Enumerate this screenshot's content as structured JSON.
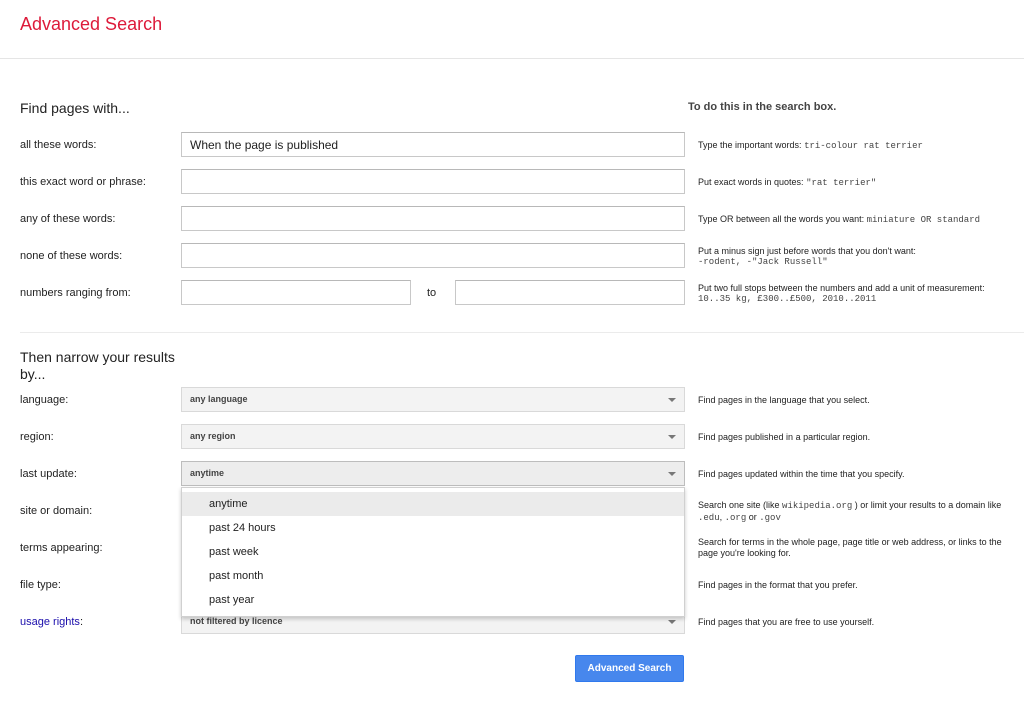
{
  "header": {
    "title": "Advanced Search"
  },
  "find": {
    "title": "Find pages with...",
    "hint_heading": "To do this in the search box.",
    "all_words": {
      "label": "all these words:",
      "value": "When the page is published",
      "hint": "Type the important words: ",
      "hint_example": "tri-colour rat terrier"
    },
    "exact_phrase": {
      "label": "this exact word or phrase:",
      "value": "",
      "hint": "Put exact words in quotes: ",
      "hint_example": "\"rat terrier\""
    },
    "any_words": {
      "label": "any of these words:",
      "value": "",
      "hint": "Type OR between all the words you want: ",
      "hint_example": "miniature OR standard"
    },
    "none_words": {
      "label": "none of these words:",
      "value": "",
      "hint": "Put a minus sign just before words that you don't want:",
      "hint_example": "-rodent, -\"Jack Russell\""
    },
    "numbers": {
      "label": "numbers ranging from:",
      "from_value": "",
      "to_label": "to",
      "to_value": "",
      "hint": "Put two full stops between the numbers and add a unit of measurement:",
      "hint_example": "10..35 kg, £300..£500, 2010..2011"
    }
  },
  "narrow": {
    "title": "Then narrow your results by...",
    "language": {
      "label": "language:",
      "value": "any language",
      "hint": "Find pages in the language that you select."
    },
    "region": {
      "label": "region:",
      "value": "any region",
      "hint": "Find pages published in a particular region."
    },
    "last_update": {
      "label": "last update:",
      "value": "anytime",
      "hint": "Find pages updated within the time that you specify."
    },
    "site": {
      "label": "site or domain:",
      "hint_1": "Search one site (like ",
      "hint_code_1": "wikipedia.org",
      "hint_2": " ) or limit your results to a domain like ",
      "hint_code_2": ".edu",
      "hint_3": ", ",
      "hint_code_3": ".org",
      "hint_4": " or ",
      "hint_code_4": ".gov"
    },
    "terms": {
      "label": "terms appearing:",
      "hint": "Search for terms in the whole page, page title or web address, or links to the page you're looking for."
    },
    "file_type": {
      "label": "file type:",
      "hint": "Find pages in the format that you prefer."
    },
    "usage_rights": {
      "label": "usage rights",
      "colon": ":",
      "value": "not filtered by licence",
      "hint": "Find pages that you are free to use yourself."
    }
  },
  "dropdown": {
    "options": [
      "anytime",
      "past 24 hours",
      "past week",
      "past month",
      "past year"
    ],
    "selected_index": 0
  },
  "submit": {
    "label": "Advanced Search"
  },
  "colors": {
    "title_red": "#dd1a3a",
    "button_blue": "#4787ed",
    "link_blue": "#1a0dab"
  }
}
